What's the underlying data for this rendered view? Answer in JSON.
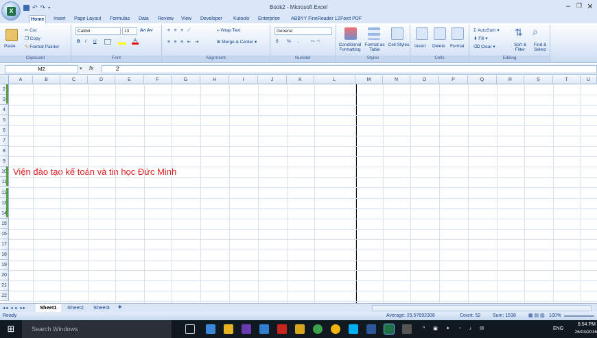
{
  "window": {
    "title": "Book2 - Microsoft Excel",
    "controls": [
      "–",
      "❐",
      "✕"
    ]
  },
  "tabs": [
    "Home",
    "Insert",
    "Page Layout",
    "Formulas",
    "Data",
    "Review",
    "View",
    "Developer",
    "Kutools",
    "Enterprise",
    "ABBYY FineReader 12",
    "Foxit PDF"
  ],
  "ribbon": {
    "clipboard": {
      "label": "Clipboard",
      "paste": "Paste",
      "cut": "Cut",
      "copy": "Copy",
      "format_painter": "Format Painter"
    },
    "font": {
      "label": "Font",
      "name": "Calibri",
      "size": "13",
      "bold": "B",
      "italic": "I",
      "underline": "U"
    },
    "alignment": {
      "label": "Alignment",
      "wrap": "Wrap Text",
      "merge": "Merge & Center"
    },
    "number": {
      "label": "Number",
      "format": "General",
      "currency": "$",
      "percent": "%",
      "comma": ","
    },
    "styles": {
      "label": "Styles",
      "conditional": "Conditional Formatting",
      "format_table": "Format as Table",
      "cell_styles": "Cell Styles"
    },
    "cells": {
      "label": "Cells",
      "insert": "Insert",
      "delete": "Delete",
      "format": "Format"
    },
    "editing": {
      "label": "Editing",
      "autosum": "AutoSum",
      "fill": "Fill",
      "clear": "Clear",
      "sort": "Sort & Filter",
      "find": "Find & Select"
    }
  },
  "formula_bar": {
    "name_box": "M2",
    "fx": "fx",
    "value": "2"
  },
  "columns": [
    "A",
    "B",
    "C",
    "D",
    "E",
    "F",
    "G",
    "H",
    "I",
    "J",
    "K",
    "L",
    "M",
    "N",
    "O",
    "P",
    "Q",
    "R",
    "S",
    "T",
    "U",
    "V"
  ],
  "rows": [
    "2",
    "3",
    "4",
    "5",
    "6",
    "7",
    "8",
    "9",
    "10",
    "11",
    "12",
    "13",
    "14",
    "15",
    "16",
    "17",
    "18",
    "19",
    "20",
    "21",
    "22"
  ],
  "cell_a10": "Viện đào tạo kế toán và tin học Đức Minh",
  "sheets": [
    "Sheet1",
    "Sheet2",
    "Sheet3"
  ],
  "status": {
    "ready": "Ready",
    "average": "Average: 29,57692308",
    "count": "Count: 52",
    "sum": "Sum: 1538",
    "zoom": "100%"
  },
  "taskbar": {
    "search": "Search Windows",
    "lang": "ENG",
    "time": "6:54 PM",
    "date": "26/03/2016"
  },
  "colors": {
    "ribbon": "#dbe7f6",
    "accent": "#15428b",
    "text_red": "#e02020"
  }
}
